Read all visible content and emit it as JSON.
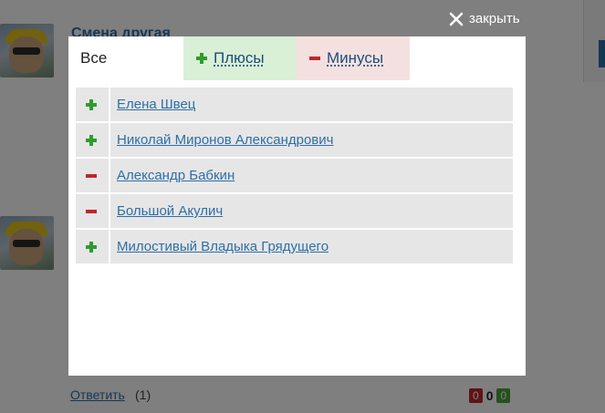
{
  "background": {
    "post_author": "Смена другая",
    "reply_link": "Ответить",
    "reply_count": "(1)",
    "votes": {
      "negative": "0",
      "total": "0",
      "positive": "0"
    }
  },
  "overlay": {
    "close_label": "закрыть",
    "close_icon": "close-icon"
  },
  "modal": {
    "tabs": [
      {
        "label": "Все",
        "active": true
      },
      {
        "label": "Плюсы",
        "sign": "plus"
      },
      {
        "label": "Минусы",
        "sign": "minus"
      }
    ],
    "voters": [
      {
        "name": "Елена Швец",
        "vote": "plus"
      },
      {
        "name": "Николай Миронов Александрович",
        "vote": "plus"
      },
      {
        "name": "Александр Бабкин",
        "vote": "minus"
      },
      {
        "name": "Большой Акулич",
        "vote": "minus"
      },
      {
        "name": "Милостивый Владыка Грядущего",
        "vote": "plus"
      }
    ]
  },
  "colors": {
    "plus": "#2e9c2e",
    "minus": "#c0262d",
    "link": "#2d6fa8",
    "plus_tab_bg": "#d9efd6",
    "minus_tab_bg": "#f5e0e0",
    "row_bg": "#e6e6e6"
  }
}
